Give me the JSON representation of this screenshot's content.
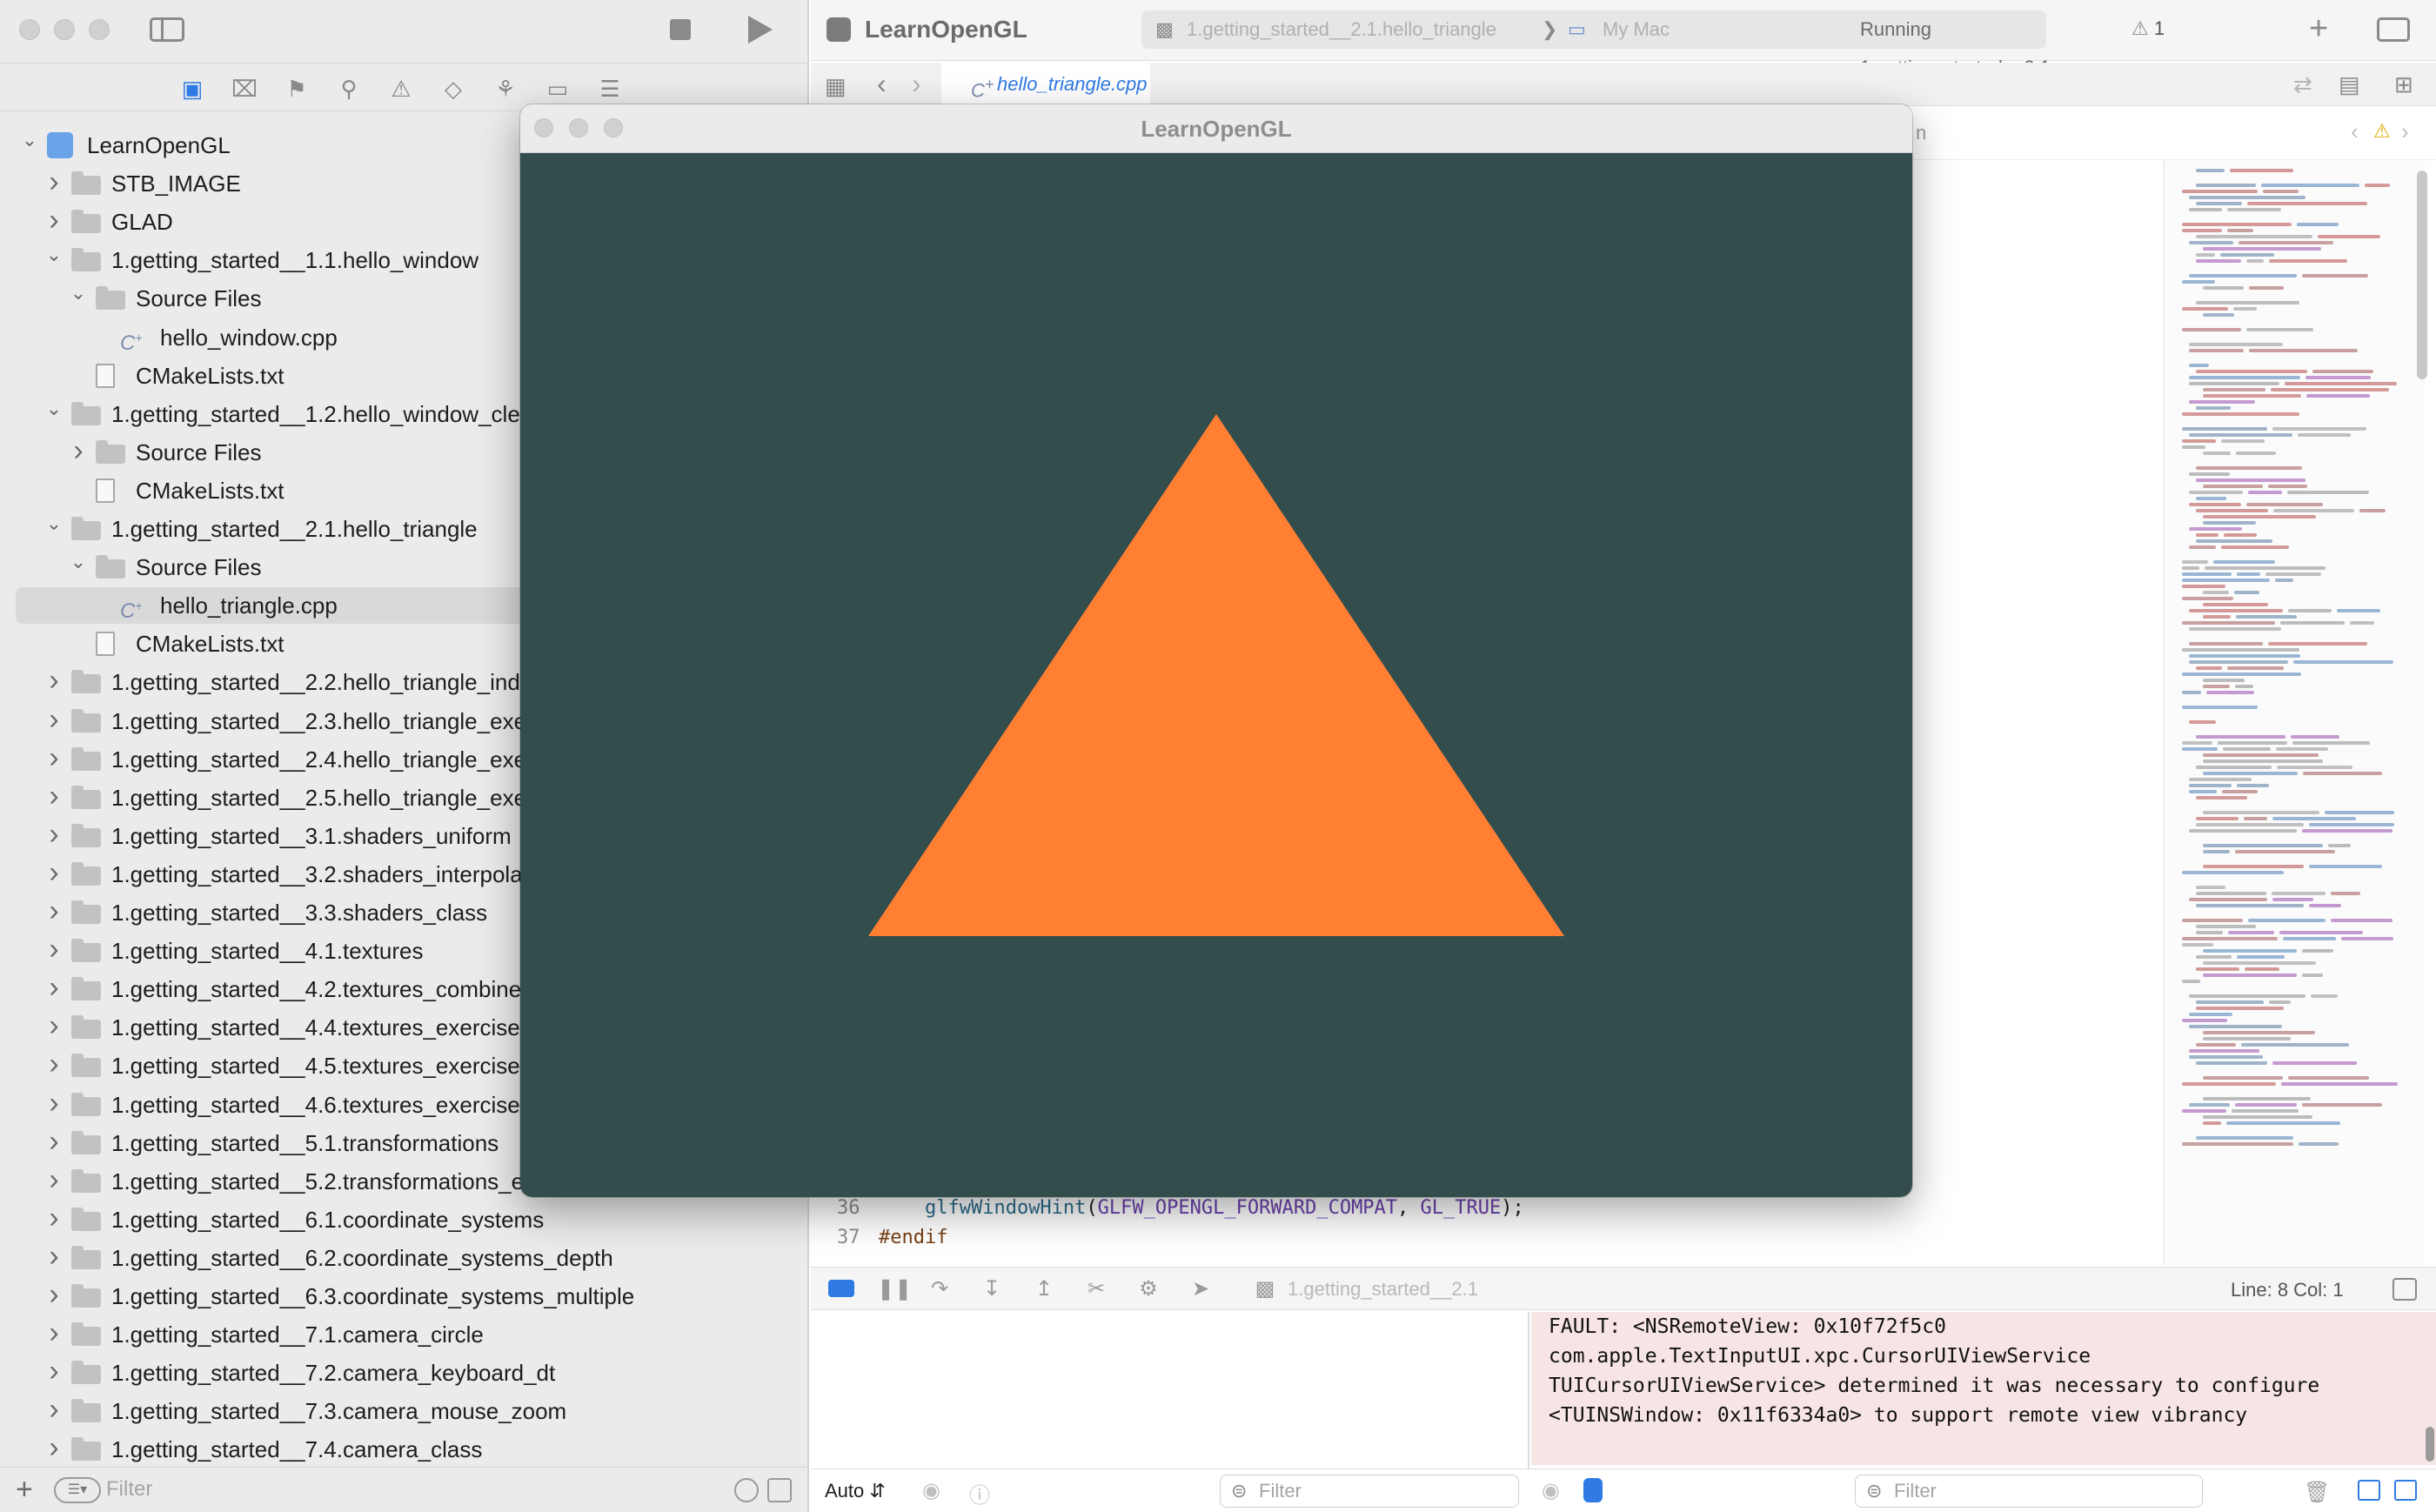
{
  "navigator": {
    "filter_placeholder": "Filter",
    "tree": [
      {
        "label": "LearnOpenGL",
        "level": 0,
        "kind": "project",
        "chevron": "down"
      },
      {
        "label": "STB_IMAGE",
        "level": 1,
        "kind": "folder",
        "chevron": "right"
      },
      {
        "label": "GLAD",
        "level": 1,
        "kind": "folder",
        "chevron": "right"
      },
      {
        "label": "1.getting_started__1.1.hello_window",
        "level": 1,
        "kind": "folder",
        "chevron": "down"
      },
      {
        "label": "Source Files",
        "level": 2,
        "kind": "folder",
        "chevron": "down"
      },
      {
        "label": "hello_window.cpp",
        "level": 3,
        "kind": "cpp",
        "chevron": ""
      },
      {
        "label": "CMakeLists.txt",
        "level": 2,
        "kind": "doc",
        "chevron": ""
      },
      {
        "label": "1.getting_started__1.2.hello_window_clear",
        "level": 1,
        "kind": "folder",
        "chevron": "down"
      },
      {
        "label": "Source Files",
        "level": 2,
        "kind": "folder",
        "chevron": "right"
      },
      {
        "label": "CMakeLists.txt",
        "level": 2,
        "kind": "doc",
        "chevron": ""
      },
      {
        "label": "1.getting_started__2.1.hello_triangle",
        "level": 1,
        "kind": "folder",
        "chevron": "down"
      },
      {
        "label": "Source Files",
        "level": 2,
        "kind": "folder",
        "chevron": "down"
      },
      {
        "label": "hello_triangle.cpp",
        "level": 3,
        "kind": "cpp",
        "chevron": "",
        "selected": true
      },
      {
        "label": "CMakeLists.txt",
        "level": 2,
        "kind": "doc",
        "chevron": ""
      },
      {
        "label": "1.getting_started__2.2.hello_triangle_indexed",
        "level": 1,
        "kind": "folder",
        "chevron": "right"
      },
      {
        "label": "1.getting_started__2.3.hello_triangle_exercise1",
        "level": 1,
        "kind": "folder",
        "chevron": "right"
      },
      {
        "label": "1.getting_started__2.4.hello_triangle_exercise2",
        "level": 1,
        "kind": "folder",
        "chevron": "right"
      },
      {
        "label": "1.getting_started__2.5.hello_triangle_exercise3",
        "level": 1,
        "kind": "folder",
        "chevron": "right"
      },
      {
        "label": "1.getting_started__3.1.shaders_uniform",
        "level": 1,
        "kind": "folder",
        "chevron": "right"
      },
      {
        "label": "1.getting_started__3.2.shaders_interpolation",
        "level": 1,
        "kind": "folder",
        "chevron": "right"
      },
      {
        "label": "1.getting_started__3.3.shaders_class",
        "level": 1,
        "kind": "folder",
        "chevron": "right"
      },
      {
        "label": "1.getting_started__4.1.textures",
        "level": 1,
        "kind": "folder",
        "chevron": "right"
      },
      {
        "label": "1.getting_started__4.2.textures_combined",
        "level": 1,
        "kind": "folder",
        "chevron": "right"
      },
      {
        "label": "1.getting_started__4.4.textures_exercise2",
        "level": 1,
        "kind": "folder",
        "chevron": "right"
      },
      {
        "label": "1.getting_started__4.5.textures_exercise3",
        "level": 1,
        "kind": "folder",
        "chevron": "right"
      },
      {
        "label": "1.getting_started__4.6.textures_exercise4",
        "level": 1,
        "kind": "folder",
        "chevron": "right"
      },
      {
        "label": "1.getting_started__5.1.transformations",
        "level": 1,
        "kind": "folder",
        "chevron": "right"
      },
      {
        "label": "1.getting_started__5.2.transformations_exercise2",
        "level": 1,
        "kind": "folder",
        "chevron": "right"
      },
      {
        "label": "1.getting_started__6.1.coordinate_systems",
        "level": 1,
        "kind": "folder",
        "chevron": "right"
      },
      {
        "label": "1.getting_started__6.2.coordinate_systems_depth",
        "level": 1,
        "kind": "folder",
        "chevron": "right"
      },
      {
        "label": "1.getting_started__6.3.coordinate_systems_multiple",
        "level": 1,
        "kind": "folder",
        "chevron": "right"
      },
      {
        "label": "1.getting_started__7.1.camera_circle",
        "level": 1,
        "kind": "folder",
        "chevron": "right"
      },
      {
        "label": "1.getting_started__7.2.camera_keyboard_dt",
        "level": 1,
        "kind": "folder",
        "chevron": "right"
      },
      {
        "label": "1.getting_started__7.3.camera_mouse_zoom",
        "level": 1,
        "kind": "folder",
        "chevron": "right"
      },
      {
        "label": "1.getting_started__7.4.camera_class",
        "level": 1,
        "kind": "folder",
        "chevron": "right"
      }
    ]
  },
  "toolbar": {
    "app_title": "LearnOpenGL",
    "scheme_target": "1.getting_started__2.1.hello_triangle",
    "scheme_destination": "My Mac",
    "status": "Running 1.getting_started__2.1",
    "warning_count": "1"
  },
  "editor": {
    "tab_file": "hello_triangle.cpp",
    "jump_fragment": "n",
    "code_lines": [
      {
        "number": "36",
        "parts": [
          {
            "t": "    ",
            "c": ""
          },
          {
            "t": "glfwWindowHint",
            "c": "fn"
          },
          {
            "t": "(",
            "c": ""
          },
          {
            "t": "GLFW_OPENGL_FORWARD_COMPAT",
            "c": "macro"
          },
          {
            "t": ", ",
            "c": ""
          },
          {
            "t": "GL_TRUE",
            "c": "macro"
          },
          {
            "t": ");",
            "c": ""
          }
        ]
      },
      {
        "number": "37",
        "parts": [
          {
            "t": "#endif",
            "c": "pp"
          }
        ]
      }
    ]
  },
  "debug": {
    "scheme_label": "1.getting_started__2.1",
    "line_col": "Line: 8  Col: 1",
    "vars_mode": "Auto",
    "vars_filter_placeholder": "Filter",
    "console_filter_placeholder": "Filter"
  },
  "console": {
    "lines": [
      "FAULT: <NSRemoteView: 0x10f72f5c0",
      "com.apple.TextInputUI.xpc.CursorUIViewService",
      "TUICursorUIViewService> determined it was necessary to configure",
      "<TUINSWindow: 0x11f6334a0> to support remote view vibrancy"
    ]
  },
  "gl_window": {
    "title": "LearnOpenGL",
    "clear_color": "#334d4d",
    "triangle_color": "#ff7f33",
    "triangle_vertices": [
      [
        -0.5,
        -0.5
      ],
      [
        0.5,
        -0.5
      ],
      [
        0.0,
        0.5
      ]
    ]
  },
  "colors": {
    "accent": "#2f7ae5",
    "console_background": "#f7e4e4",
    "selection": "#d9d9d9"
  }
}
